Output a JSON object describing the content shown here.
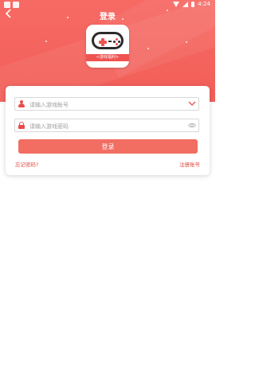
{
  "status_bar": {
    "time": "4:24"
  },
  "header": {
    "title": "登录"
  },
  "logo": {
    "band_text": "<游戏福利>"
  },
  "form": {
    "account_placeholder": "请输入游戏帐号",
    "password_placeholder": "请输入游戏密码",
    "account_value": "",
    "password_value": "",
    "login_label": "登录",
    "forgot_label": "忘记密码?",
    "register_label": "注册账号"
  },
  "colors": {
    "accent": "#f26d62",
    "header_bg": "#f46660",
    "link": "#e04a40"
  }
}
